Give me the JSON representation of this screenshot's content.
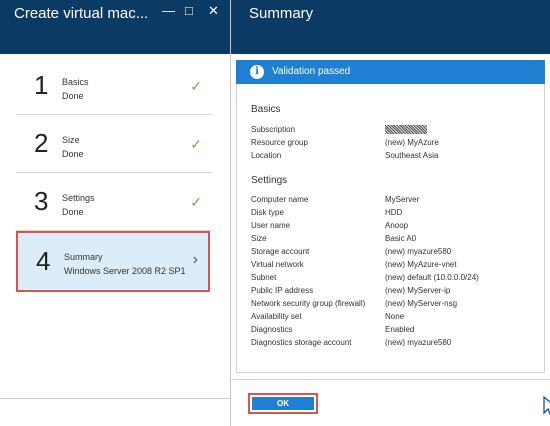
{
  "left_blade": {
    "title": "Create virtual mac...",
    "controls": [
      "—",
      "□",
      "✕"
    ],
    "steps": [
      {
        "num": "1",
        "name": "Basics",
        "status": "Done"
      },
      {
        "num": "2",
        "name": "Size",
        "status": "Done"
      },
      {
        "num": "3",
        "name": "Settings",
        "status": "Done"
      },
      {
        "num": "4",
        "name": "Summary",
        "status": "Windows Server 2008 R2 SP1"
      }
    ]
  },
  "right_blade": {
    "title": "Summary",
    "validation": "Validation passed",
    "basics": {
      "heading": "Basics",
      "rows": [
        {
          "k": "Subscription",
          "v": ""
        },
        {
          "k": "Resource group",
          "v": "(new) MyAzure"
        },
        {
          "k": "Location",
          "v": "Southeast Asia"
        }
      ]
    },
    "settings": {
      "heading": "Settings",
      "rows": [
        {
          "k": "Computer name",
          "v": "MyServer"
        },
        {
          "k": "Disk type",
          "v": "HDD"
        },
        {
          "k": "User name",
          "v": "Anoop"
        },
        {
          "k": "Size",
          "v": "Basic A0"
        },
        {
          "k": "Storage account",
          "v": "(new) myazure580"
        },
        {
          "k": "Virtual network",
          "v": "(new) MyAzure-vnet"
        },
        {
          "k": "Subnet",
          "v": "(new) default (10.0.0.0/24)"
        },
        {
          "k": "Public IP address",
          "v": "(new) MyServer-ip"
        },
        {
          "k": "Network security group (firewall)",
          "v": "(new) MyServer-nsg"
        },
        {
          "k": "Availability set",
          "v": "None"
        },
        {
          "k": "Diagnostics",
          "v": "Enabled"
        },
        {
          "k": "Diagnostics storage account",
          "v": "(new) myazure580"
        }
      ]
    },
    "ok_label": "OK"
  },
  "colors": {
    "header": "#0b3a64",
    "accent": "#1e7fd3",
    "highlight": "#d9534f",
    "check": "#6ab23d"
  },
  "icons": {
    "check": "checkmark-icon",
    "chevron": "chevron-right-icon",
    "info": "info-icon"
  }
}
